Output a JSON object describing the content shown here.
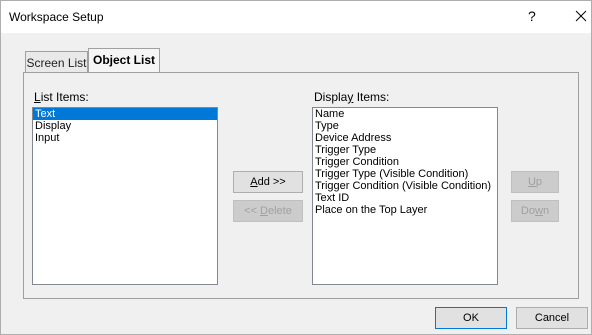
{
  "window": {
    "title": "Workspace Setup",
    "help_glyph": "?"
  },
  "tabs": [
    {
      "label": "Screen List",
      "active": false
    },
    {
      "label": "Object List",
      "active": true
    }
  ],
  "list_items": {
    "label_prefix": "",
    "label_accel": "L",
    "label_rest": "ist Items:",
    "items": [
      "Text",
      "Display",
      "Input"
    ],
    "selected_index": 0
  },
  "display_items": {
    "label_prefix": "Displa",
    "label_accel": "y",
    "label_rest": " Items:",
    "items": [
      "Name",
      "Type",
      "Device Address",
      "Trigger Type",
      "Trigger Condition",
      "Trigger Type (Visible Condition)",
      "Trigger Condition (Visible Condition)",
      "Text ID",
      "Place on the Top Layer"
    ]
  },
  "buttons": {
    "add": {
      "prefix": "",
      "accel": "A",
      "rest": "dd >>"
    },
    "delete": {
      "prefix": "<< ",
      "accel": "D",
      "rest": "elete"
    },
    "up": {
      "prefix": "",
      "accel": "U",
      "rest": "p"
    },
    "down": {
      "prefix": "Do",
      "accel": "w",
      "rest": "n"
    },
    "ok": "OK",
    "cancel": "Cancel"
  }
}
